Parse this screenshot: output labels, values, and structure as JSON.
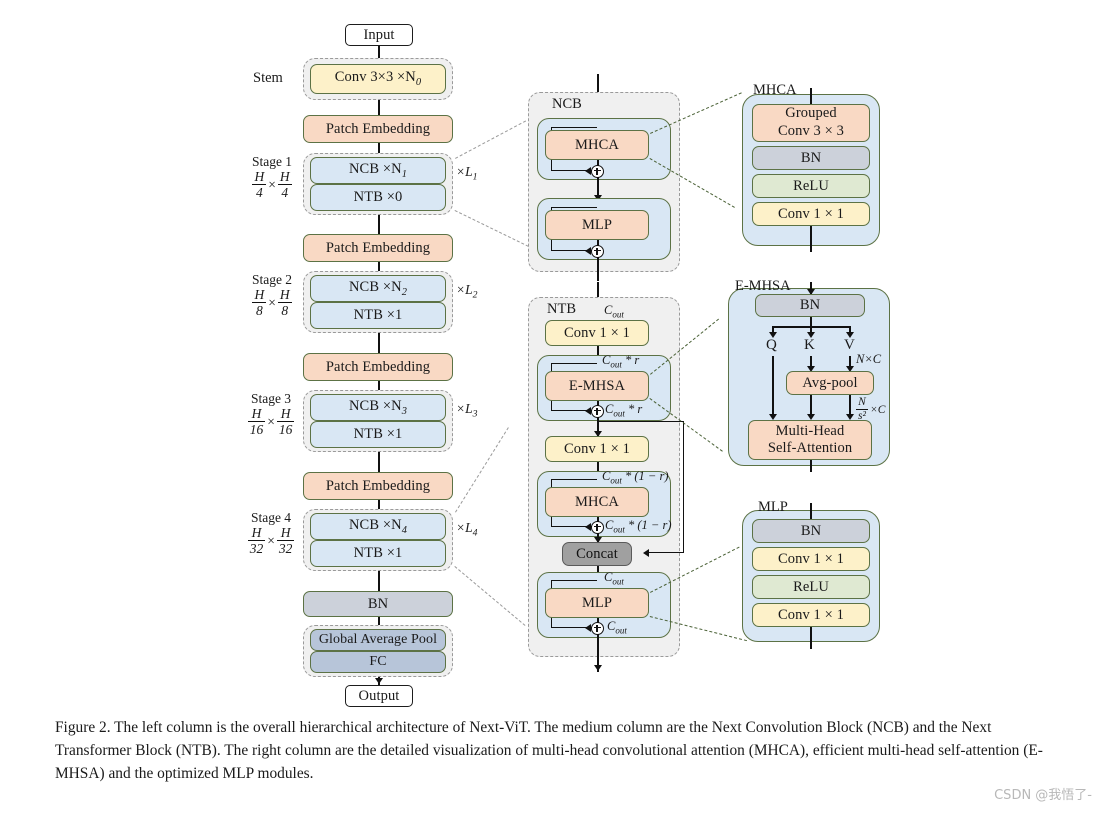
{
  "figure": {
    "caption": "Figure 2. The left column is the overall hierarchical architecture of Next-ViT. The medium column are the Next Convolution Block (NCB) and the Next Transformer Block (NTB). The right column are the detailed visualization of multi-head convolutional attention (MHCA), efficient multi-head self-attention (E-MHSA) and the optimized MLP modules.",
    "watermark": "CSDN @我悟了-"
  },
  "left_column": {
    "input_label": "Input",
    "output_label": "Output",
    "stem_label": "Stem",
    "stem_block": "Conv 3×3 ×N",
    "stem_block_sub": "0",
    "patch_embedding": "Patch Embedding",
    "bn": "BN",
    "global_average_pool": "Global Average Pool",
    "fc": "FC",
    "stages": [
      {
        "name": "Stage 1",
        "res_num": "H",
        "res_den": "4",
        "ncb": "NCB ×N",
        "ncb_sub": "1",
        "ntb": "NTB ×0",
        "repeat": "×L",
        "repeat_sub": "1"
      },
      {
        "name": "Stage 2",
        "res_num": "H",
        "res_den": "8",
        "ncb": "NCB ×N",
        "ncb_sub": "2",
        "ntb": "NTB ×1",
        "repeat": "×L",
        "repeat_sub": "2"
      },
      {
        "name": "Stage 3",
        "res_num": "H",
        "res_den": "16",
        "ncb": "NCB ×N",
        "ncb_sub": "3",
        "ntb": "NTB ×1",
        "repeat": "×L",
        "repeat_sub": "3"
      },
      {
        "name": "Stage 4",
        "res_num": "H",
        "res_den": "32",
        "ncb": "NCB ×N",
        "ncb_sub": "4",
        "ntb": "NTB ×1",
        "repeat": "×L",
        "repeat_sub": "4"
      }
    ]
  },
  "ncb_block": {
    "title": "NCB",
    "mhca": "MHCA",
    "mlp": "MLP"
  },
  "ntb_block": {
    "title": "NTB",
    "conv1": "Conv 1 × 1",
    "conv2": "Conv 1 × 1",
    "emhsa": "E-MHSA",
    "mhca": "MHCA",
    "concat": "Concat",
    "mlp": "MLP",
    "labels": {
      "c_out_in": "C",
      "c_out_sub": "out",
      "c_out_r_top": "C",
      "c_out_r_top_sub": "out",
      "c_out_r_top_suffix": " * r",
      "c_out_r_add": " * r",
      "c_out_1mr_top": " * (1 − r)",
      "c_out_1mr_add": " * (1 − r)",
      "c_out_mlp_top": "",
      "c_out_mlp_add": ""
    }
  },
  "mhca_detail": {
    "title": "MHCA",
    "rows": [
      {
        "label": "Grouped\nConv 3 × 3",
        "color": "peach"
      },
      {
        "label": "BN",
        "color": "grey"
      },
      {
        "label": "ReLU",
        "color": "green"
      },
      {
        "label": "Conv 1 × 1",
        "color": "yellow"
      }
    ],
    "grouped_line1": "Grouped",
    "grouped_line2": "Conv 3 × 3",
    "bn": "BN",
    "relu": "ReLU",
    "conv": "Conv 1 × 1"
  },
  "emhsa_detail": {
    "title": "E-MHSA",
    "bn": "BN",
    "q": "Q",
    "k": "K",
    "v": "V",
    "avg_pool": "Avg-pool",
    "attention_line1": "Multi-Head",
    "attention_line2": "Self-Attention",
    "dim_v": "N×C",
    "dim_pool_num": "N",
    "dim_pool_den": "s²",
    "dim_pool_suffix": "×C"
  },
  "mlp_detail": {
    "title": "MLP",
    "bn": "BN",
    "conv1": "Conv 1 × 1",
    "relu": "ReLU",
    "conv2": "Conv 1 × 1"
  },
  "colors": {
    "yellow": "#fdf1c9",
    "peach": "#f9d9c4",
    "blue": "#d9e7f4",
    "green": "#dfe9d2",
    "grey": "#ccd1da",
    "dark_blue": "#b7c5d9",
    "concat_grey": "#a0a0a0",
    "border_green": "#5c7245",
    "leader_green": "#4a6136"
  }
}
